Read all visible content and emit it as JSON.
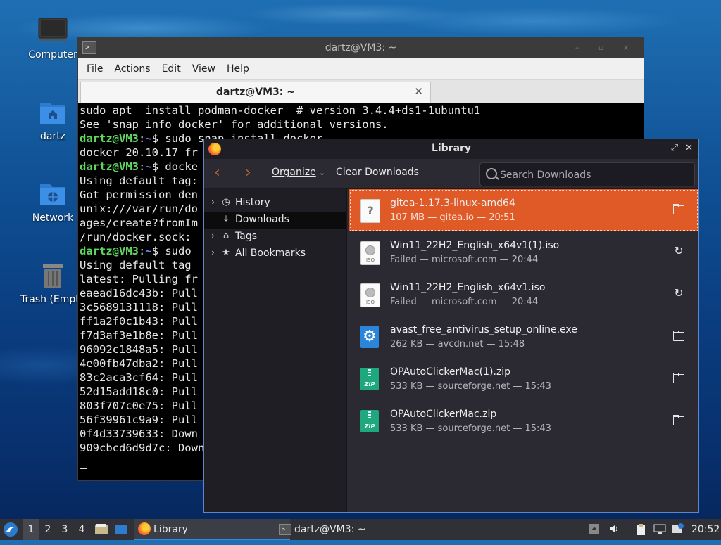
{
  "desktop": {
    "icons": [
      {
        "label": "Computer",
        "icon": "computer-icon"
      },
      {
        "label": "dartz",
        "icon": "home-folder-icon"
      },
      {
        "label": "Network",
        "icon": "network-folder-icon"
      },
      {
        "label": "Trash (Empt",
        "icon": "trash-icon"
      }
    ]
  },
  "terminal": {
    "title": "dartz@VM3: ~",
    "menu": [
      "File",
      "Actions",
      "Edit",
      "View",
      "Help"
    ],
    "tab_label": "dartz@VM3: ~",
    "prompt_user": "dartz@VM3",
    "prompt_path": "~",
    "lines": [
      {
        "text": "sudo apt  install podman-docker  # version 3.4.4+ds1-1ubuntu1"
      },
      {
        "text": "See 'snap info docker' for additional versions."
      },
      {
        "prompt": true,
        "text": "sudo snap install docker"
      },
      {
        "text": "docker 20.10.17 fr"
      },
      {
        "prompt": true,
        "text": "docke"
      },
      {
        "text": "Using default tag:"
      },
      {
        "text": "Got permission den"
      },
      {
        "text": "unix:///var/run/do"
      },
      {
        "text": "ages/create?fromIm"
      },
      {
        "text": "/run/docker.sock:"
      },
      {
        "prompt": true,
        "text": "sudo"
      },
      {
        "text": "Using default tag"
      },
      {
        "text": "latest: Pulling fr"
      },
      {
        "text": "eaead16dc43b: Pull"
      },
      {
        "text": "3c5689131118: Pull"
      },
      {
        "text": "ff1a2f0c1b43: Pull"
      },
      {
        "text": "f7d3af3e1b8e: Pull"
      },
      {
        "text": "96092c1848a5: Pull"
      },
      {
        "text": "4e00fb47dba2: Pull"
      },
      {
        "text": "83c2aca3cf64: Pull"
      },
      {
        "text": "52d15add18c0: Pull"
      },
      {
        "text": "803f707c0e75: Pull"
      },
      {
        "text": "56f39961c9a9: Pull"
      },
      {
        "text": "0f4d33739633: Down"
      },
      {
        "text": "909cbcd6d9d7c: Down"
      }
    ]
  },
  "library": {
    "title": "Library",
    "toolbar": {
      "organize_label": "Organize",
      "clear_label": "Clear Downloads",
      "search_placeholder": "Search Downloads"
    },
    "sidebar": [
      {
        "label": "History",
        "icon": "clock-icon",
        "expandable": true
      },
      {
        "label": "Downloads",
        "icon": "download-icon",
        "expandable": false,
        "selected": true
      },
      {
        "label": "Tags",
        "icon": "tag-icon",
        "expandable": true
      },
      {
        "label": "All Bookmarks",
        "icon": "star-icon",
        "expandable": true
      }
    ],
    "downloads": [
      {
        "name": "gitea-1.17.3-linux-amd64",
        "meta": "107 MB — gitea.io — 20:51",
        "icon": "unknown-file-icon",
        "action": "folder-icon",
        "selected": true
      },
      {
        "name": "Win11_22H2_English_x64v1(1).iso",
        "meta": "Failed — microsoft.com — 20:44",
        "icon": "iso-file-icon",
        "action": "retry-icon"
      },
      {
        "name": "Win11_22H2_English_x64v1.iso",
        "meta": "Failed — microsoft.com — 20:44",
        "icon": "iso-file-icon",
        "action": "retry-icon"
      },
      {
        "name": "avast_free_antivirus_setup_online.exe",
        "meta": "262 KB — avcdn.net — 15:48",
        "icon": "exe-file-icon",
        "action": "folder-icon"
      },
      {
        "name": "OPAutoClickerMac(1).zip",
        "meta": "533 KB — sourceforge.net — 15:43",
        "icon": "zip-file-icon",
        "action": "folder-icon"
      },
      {
        "name": "OPAutoClickerMac.zip",
        "meta": "533 KB — sourceforge.net — 15:43",
        "icon": "zip-file-icon",
        "action": "folder-icon"
      }
    ]
  },
  "taskbar": {
    "workspaces": [
      "1",
      "2",
      "3",
      "4"
    ],
    "tasks": [
      {
        "label": "Library",
        "icon": "firefox-icon",
        "active": true
      },
      {
        "label": "dartz@VM3: ~",
        "icon": "terminal-icon",
        "active": false
      }
    ],
    "clock": "20:52"
  }
}
